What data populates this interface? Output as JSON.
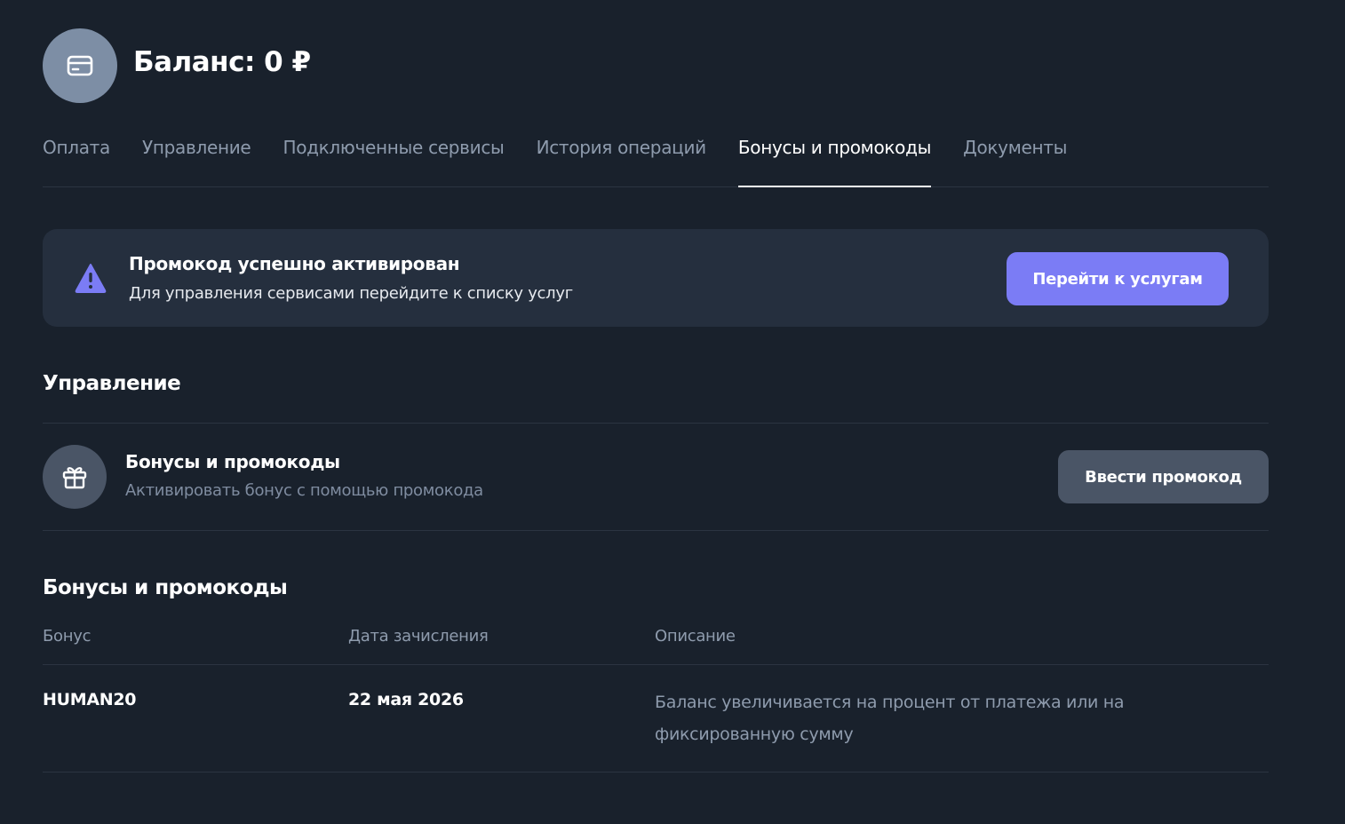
{
  "header": {
    "balance_title": "Баланс: 0 ₽",
    "icon": "credit-card-icon"
  },
  "tabs": [
    {
      "label": "Оплата",
      "active": false
    },
    {
      "label": "Управление",
      "active": false
    },
    {
      "label": "Подключенные сервисы",
      "active": false
    },
    {
      "label": "История операций",
      "active": false
    },
    {
      "label": "Бонусы и промокоды",
      "active": true
    },
    {
      "label": "Документы",
      "active": false
    }
  ],
  "alert": {
    "icon": "warning-icon",
    "title": "Промокод успешно активирован",
    "text": "Для управления сервисами перейдите к списку услуг",
    "button_label": "Перейти к услугам"
  },
  "management": {
    "title": "Управление",
    "item": {
      "icon": "gift-icon",
      "title": "Бонусы и промокоды",
      "description": "Активировать бонус с помощью промокода",
      "button_label": "Ввести промокод"
    }
  },
  "bonuses": {
    "title": "Бонусы и промокоды",
    "columns": [
      "Бонус",
      "Дата зачисления",
      "Описание"
    ],
    "rows": [
      {
        "bonus": "HUMAN20",
        "date": "22 мая 2026",
        "description": "Баланс увеличивается на процент от платежа или на фиксированную сумму"
      }
    ]
  },
  "colors": {
    "background": "#19212c",
    "accent": "#7b7cf5",
    "card": "#252f3e",
    "muted_text": "#8e9bad"
  }
}
